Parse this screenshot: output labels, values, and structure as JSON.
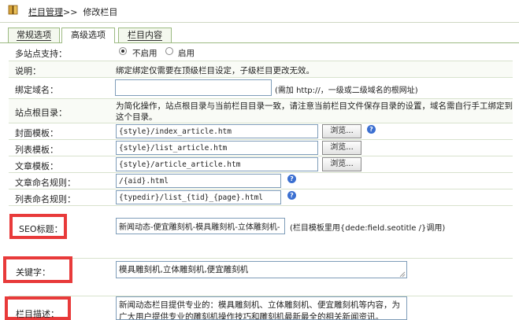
{
  "breadcrumb": {
    "section": "栏目管理",
    "separator": ">>",
    "current": "修改栏目"
  },
  "tabs": [
    {
      "label": "常规选项",
      "active": false
    },
    {
      "label": "高级选项",
      "active": true
    },
    {
      "label": "栏目内容",
      "active": false
    }
  ],
  "multisite": {
    "label": "多站点支持：",
    "options": [
      "不启用",
      "启用"
    ],
    "selected": "不启用"
  },
  "explain": {
    "label": "说明：",
    "text": "绑定绑定仅需要在顶级栏目设定，子级栏目更改无效。"
  },
  "bind_domain": {
    "label": "绑定域名：",
    "value": "",
    "note": "(需加 http://，一级或二级域名的根网址)"
  },
  "site_root": {
    "label": "站点根目录：",
    "text_line1": "为简化操作，站点根目录与当前栏目目录一致，请注意当前栏目文件保存目录的设置，域名需自行手工绑定到",
    "text_line2": "这个目录。"
  },
  "cover_template": {
    "label": "封面模板：",
    "value": "{style}/index_article.htm",
    "button": "浏览..."
  },
  "list_template": {
    "label": "列表模板：",
    "value": "{style}/list_article.htm",
    "button": "浏览..."
  },
  "article_template": {
    "label": "文章模板：",
    "value": "{style}/article_article.htm",
    "button": "浏览..."
  },
  "article_naming": {
    "label": "文章命名规则：",
    "value": "/{aid}.html"
  },
  "list_naming": {
    "label": "列表命名规则：",
    "value": "{typedir}/list_{tid}_{page}.html"
  },
  "seo_title": {
    "label": "SEO标题：",
    "value": "新闻动态-便宜雕刻机-模具雕刻机-立体雕刻机-",
    "note": "(栏目模板里用{dede:field.seotitle /}调用)"
  },
  "keywords": {
    "label": "关键字：",
    "value": "模具雕刻机,立体雕刻机,便宜雕刻机"
  },
  "description": {
    "label": "栏目描述：",
    "value": "新闻动态栏目提供专业的：模具雕刻机、立体雕刻机、便宜雕刻机等内容，为广大用户提供专业的雕刻机操作技巧和雕刻机最新最全的相关新闻资讯。"
  },
  "help_icon": "help-icon",
  "colors": {
    "highlight_border": "#e83a3a",
    "tab_border": "#9cba82",
    "row_divider": "#d8e2cd"
  }
}
